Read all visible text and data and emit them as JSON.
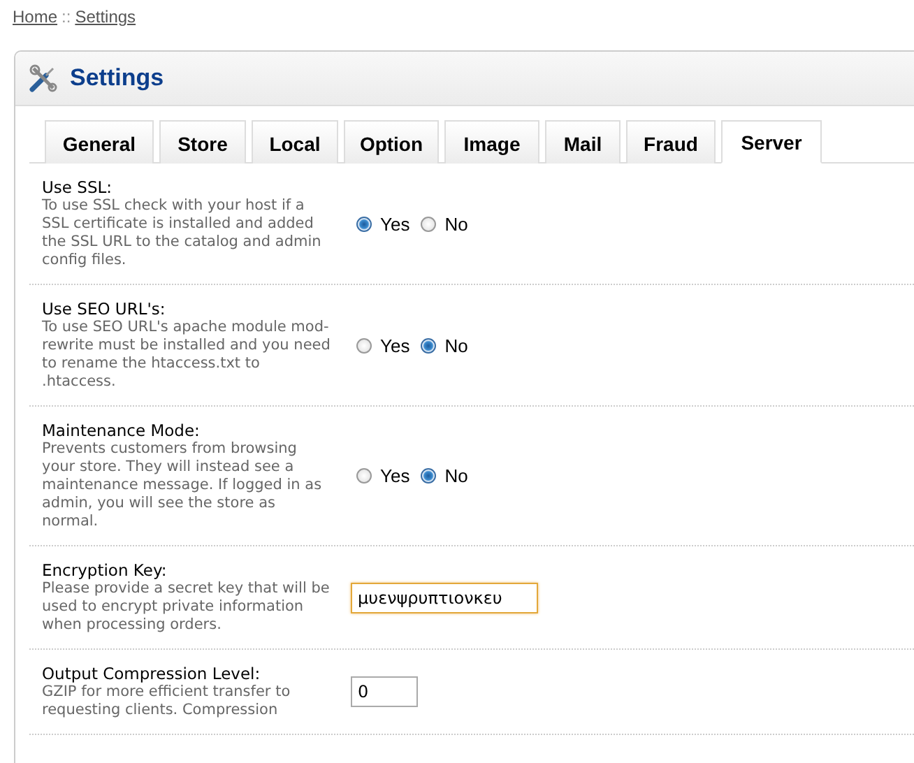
{
  "breadcrumb": [
    {
      "label": "Home"
    },
    {
      "label": "Settings"
    }
  ],
  "breadcrumb_separator": "::",
  "panel": {
    "title": "Settings"
  },
  "tabs": [
    {
      "label": "General",
      "selected": false
    },
    {
      "label": "Store",
      "selected": false
    },
    {
      "label": "Local",
      "selected": false
    },
    {
      "label": "Option",
      "selected": false
    },
    {
      "label": "Image",
      "selected": false
    },
    {
      "label": "Mail",
      "selected": false
    },
    {
      "label": "Fraud",
      "selected": false
    },
    {
      "label": "Server",
      "selected": true
    }
  ],
  "settings": [
    {
      "kind": "radio",
      "label": "Use SSL:",
      "description": "To use SSL check with your host if a SSL certificate is installed and added the SSL URL to the catalog and admin config files.",
      "options": [
        {
          "label": "Yes",
          "selected": true
        },
        {
          "label": "No",
          "selected": false
        }
      ]
    },
    {
      "kind": "radio",
      "label": "Use SEO URL's:",
      "description": "To use SEO URL's apache module mod-rewrite must be installed and you need to rename the htaccess.txt to .htaccess.",
      "options": [
        {
          "label": "Yes",
          "selected": false
        },
        {
          "label": "No",
          "selected": true
        }
      ]
    },
    {
      "kind": "radio",
      "label": "Maintenance Mode:",
      "description": "Prevents customers from browsing your store. They will instead see a maintenance message. If logged in as admin, you will see the store as normal.",
      "options": [
        {
          "label": "Yes",
          "selected": false
        },
        {
          "label": "No",
          "selected": true
        }
      ]
    },
    {
      "kind": "text",
      "label": "Encryption Key:",
      "description": "Please provide a secret key that will be used to encrypt private information when processing orders.",
      "value": "μυενψρυπτιονκευ",
      "focused": true
    },
    {
      "kind": "number",
      "label": "Output Compression Level:",
      "description": "GZIP for more efficient transfer to requesting clients. Compression",
      "value": "0",
      "focused": false
    }
  ]
}
